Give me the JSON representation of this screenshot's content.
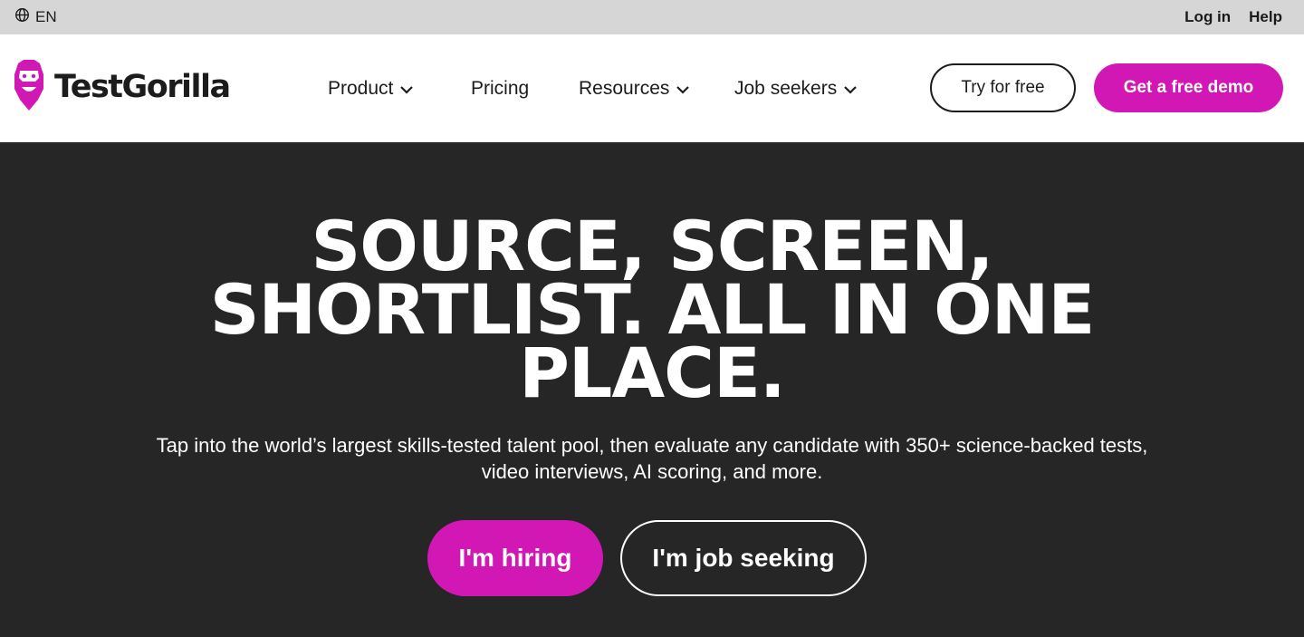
{
  "topbar": {
    "language": "EN",
    "language_icon": "globe-icon",
    "login": "Log in",
    "help": "Help"
  },
  "nav": {
    "logo_text": "TestGorilla",
    "logo_icon": "gorilla-logo-icon",
    "items": [
      {
        "label": "Product",
        "has_dropdown": true
      },
      {
        "label": "Pricing",
        "has_dropdown": false
      },
      {
        "label": "Resources",
        "has_dropdown": true
      },
      {
        "label": "Job seekers",
        "has_dropdown": true
      }
    ],
    "try_free": "Try for free",
    "demo": "Get a free demo"
  },
  "hero": {
    "headline_line1": "SOURCE, SCREEN,",
    "headline_line2": "SHORTLIST. ALL IN ONE",
    "headline_line3": "PLACE.",
    "subtext": "Tap into the world’s largest skills-tested talent pool, then evaluate any candidate with 350+ science-backed tests, video interviews, AI scoring, and more.",
    "hiring_button": "I'm hiring",
    "seeking_button": "I'm job seeking"
  },
  "colors": {
    "brand_pink": "#d118b4",
    "hero_bg": "#262626",
    "topbar_bg": "#d6d6d6"
  }
}
